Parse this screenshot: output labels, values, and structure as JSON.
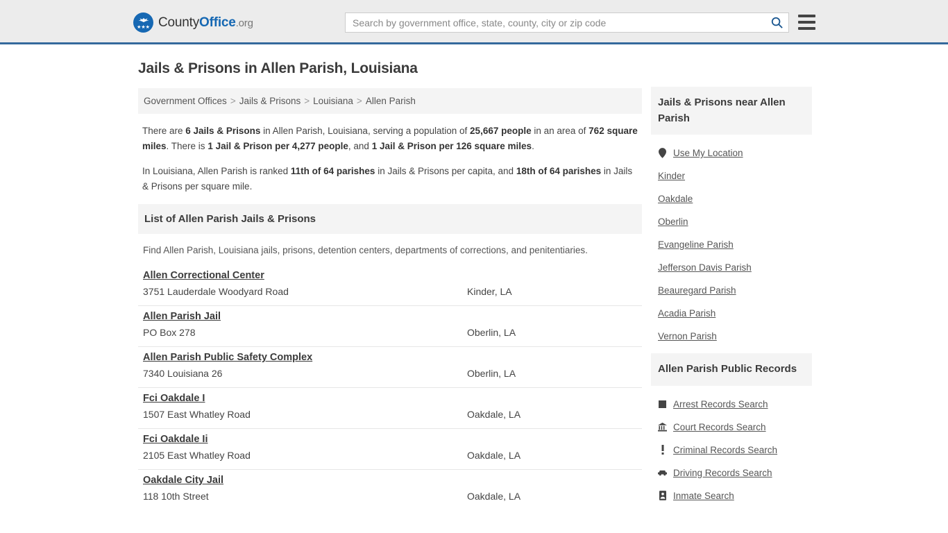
{
  "header": {
    "logo": {
      "part1": "County",
      "part2": "Office",
      "part3": ".org",
      "icon": "eagle-seal-icon"
    },
    "search": {
      "placeholder": "Search by government office, state, county, city or zip code",
      "value": "",
      "button_icon": "search-icon"
    },
    "menu_icon": "hamburger-menu-icon",
    "accent_color": "#34699c",
    "background_color": "#ececec"
  },
  "main": {
    "title": "Jails & Prisons in Allen Parish, Louisiana",
    "breadcrumb": [
      "Government Offices",
      "Jails & Prisons",
      "Louisiana",
      "Allen Parish"
    ],
    "breadcrumb_separator": ">",
    "stats": {
      "paragraph1": {
        "seg1": "There are ",
        "b1": "6 Jails & Prisons",
        "seg2": " in Allen Parish, Louisiana, serving a population of ",
        "b2": "25,667 people",
        "seg3": " in an area of ",
        "b3": "762 square miles",
        "seg4": ". There is ",
        "b4": "1 Jail & Prison per 4,277 people",
        "seg5": ", and ",
        "b5": "1 Jail & Prison per 126 square miles",
        "seg6": "."
      },
      "paragraph2": {
        "seg1": "In Louisiana, Allen Parish is ranked ",
        "b1": "11th of 64 parishes",
        "seg2": " in Jails & Prisons per capita, and ",
        "b2": "18th of 64 parishes",
        "seg3": " in Jails & Prisons per square mile."
      }
    },
    "list_section": {
      "heading": "List of Allen Parish Jails & Prisons",
      "subtitle": "Find Allen Parish, Louisiana jails, prisons, detention centers, departments of corrections, and penitentiaries.",
      "listings": [
        {
          "name": "Allen Correctional Center",
          "address": "3751 Lauderdale Woodyard Road",
          "city": "Kinder, LA"
        },
        {
          "name": "Allen Parish Jail",
          "address": "PO Box 278",
          "city": "Oberlin, LA"
        },
        {
          "name": "Allen Parish Public Safety Complex",
          "address": "7340 Louisiana 26",
          "city": "Oberlin, LA"
        },
        {
          "name": "Fci Oakdale I",
          "address": "1507 East Whatley Road",
          "city": "Oakdale, LA"
        },
        {
          "name": "Fci Oakdale Ii",
          "address": "2105 East Whatley Road",
          "city": "Oakdale, LA"
        },
        {
          "name": "Oakdale City Jail",
          "address": "118 10th Street",
          "city": "Oakdale, LA"
        }
      ]
    }
  },
  "sidebar": {
    "nearby": {
      "heading": "Jails & Prisons near Allen Parish",
      "items": [
        {
          "label": "Use My Location",
          "icon": "map-pin-icon"
        },
        {
          "label": "Kinder",
          "icon": ""
        },
        {
          "label": "Oakdale",
          "icon": ""
        },
        {
          "label": "Oberlin",
          "icon": ""
        },
        {
          "label": "Evangeline Parish",
          "icon": ""
        },
        {
          "label": "Jefferson Davis Parish",
          "icon": ""
        },
        {
          "label": "Beauregard Parish",
          "icon": ""
        },
        {
          "label": "Acadia Parish",
          "icon": ""
        },
        {
          "label": "Vernon Parish",
          "icon": ""
        }
      ]
    },
    "public_records": {
      "heading": "Allen Parish Public Records",
      "items": [
        {
          "label": "Arrest Records Search",
          "icon": "fingerprint-square-icon"
        },
        {
          "label": "Court Records Search",
          "icon": "courthouse-icon"
        },
        {
          "label": "Criminal Records Search",
          "icon": "exclamation-icon"
        },
        {
          "label": "Driving Records Search",
          "icon": "car-icon"
        },
        {
          "label": "Inmate Search",
          "icon": "id-badge-icon"
        }
      ]
    }
  }
}
